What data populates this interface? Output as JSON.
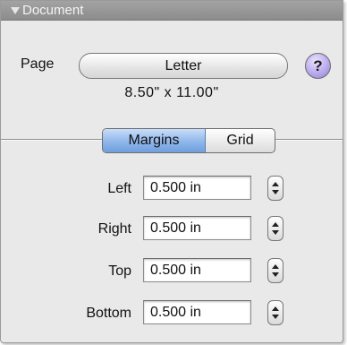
{
  "header": {
    "title": "Document"
  },
  "page": {
    "label": "Page",
    "selected": "Letter",
    "size_text": "8.50\" x 11.00\"",
    "help_glyph": "?"
  },
  "tabs": [
    {
      "label": "Margins",
      "active": true
    },
    {
      "label": "Grid",
      "active": false
    }
  ],
  "margins": [
    {
      "label": "Left",
      "value": "0.500 in"
    },
    {
      "label": "Right",
      "value": "0.500 in"
    },
    {
      "label": "Top",
      "value": "0.500 in"
    },
    {
      "label": "Bottom",
      "value": "0.500 in"
    }
  ],
  "colors": {
    "header_bg": "#9a9a9a",
    "panel_bg": "#e9e9e9",
    "active_tab": "#8fb6ea",
    "help_button": "#b7a6ea"
  }
}
